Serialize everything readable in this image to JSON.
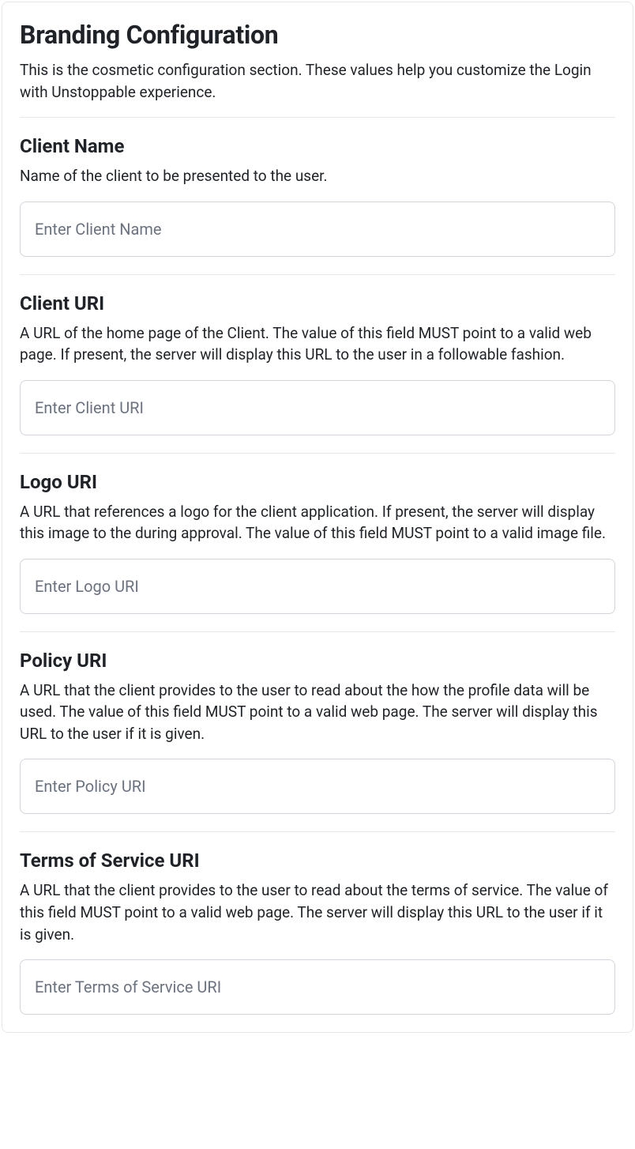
{
  "header": {
    "title": "Branding Configuration",
    "intro": "This is the cosmetic configuration section. These values help you customize the Login with Unstoppable experience."
  },
  "sections": {
    "client_name": {
      "title": "Client Name",
      "desc": "Name of the client to be presented to the user.",
      "placeholder": "Enter Client Name",
      "value": ""
    },
    "client_uri": {
      "title": "Client URI",
      "desc": "A URL of the home page of the Client. The value of this field MUST point to a valid web page. If present, the server will display this URL to the user in a followable fashion.",
      "placeholder": "Enter Client URI",
      "value": ""
    },
    "logo_uri": {
      "title": "Logo URI",
      "desc": "A URL that references a logo for the client application. If present, the server will display this image to the during approval. The value of this field MUST point to a valid image file.",
      "placeholder": "Enter Logo URI",
      "value": ""
    },
    "policy_uri": {
      "title": "Policy URI",
      "desc": "A URL that the client provides to the user to read about the how the profile data will be used. The value of this field MUST point to a valid web page. The server will display this URL to the user if it is given.",
      "placeholder": "Enter Policy URI",
      "value": ""
    },
    "tos_uri": {
      "title": "Terms of Service URI",
      "desc": "A URL that the client provides to the user to read about the terms of service. The value of this field MUST point to a valid web page. The server will display this URL to the user if it is given.",
      "placeholder": "Enter Terms of Service URI",
      "value": ""
    }
  }
}
